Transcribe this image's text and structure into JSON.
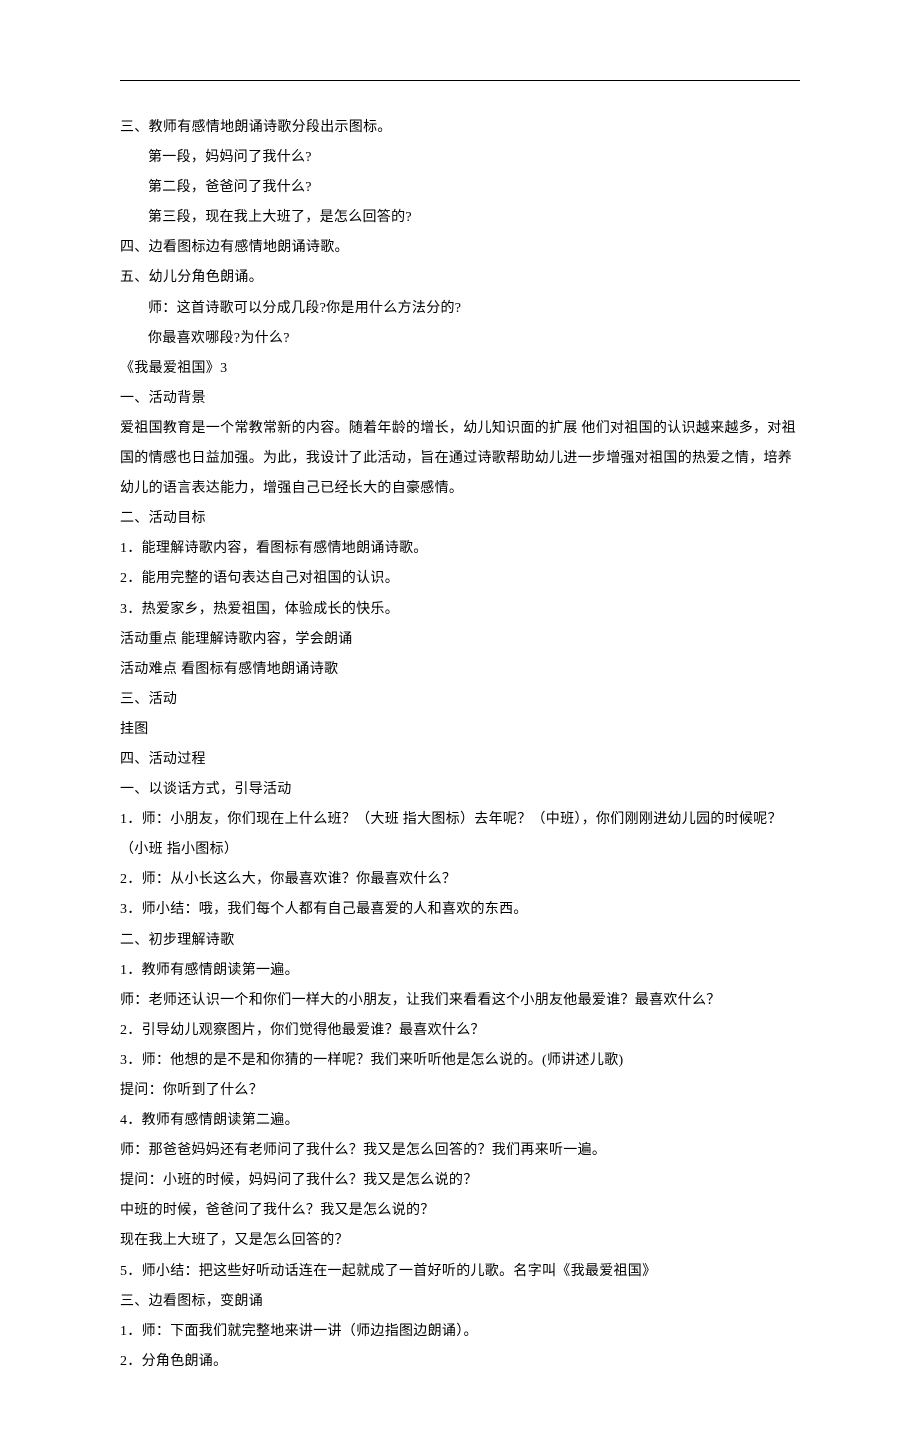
{
  "lines": [
    {
      "t": "三、教师有感情地朗诵诗歌分段出示图标。",
      "i": 0
    },
    {
      "t": "第一段，妈妈问了我什么?",
      "i": 1
    },
    {
      "t": "第二段，爸爸问了我什么?",
      "i": 1
    },
    {
      "t": "第三段，现在我上大班了，是怎么回答的?",
      "i": 1
    },
    {
      "t": "四、边看图标边有感情地朗诵诗歌。",
      "i": 0
    },
    {
      "t": "五、幼儿分角色朗诵。",
      "i": 0
    },
    {
      "t": "师：这首诗歌可以分成几段?你是用什么方法分的?",
      "i": 1
    },
    {
      "t": "你最喜欢哪段?为什么?",
      "i": 1
    },
    {
      "t": "《我最爱祖国》3",
      "i": 0
    },
    {
      "t": "一、活动背景",
      "i": 0
    },
    {
      "t": "爱祖国教育是一个常教常新的内容。随着年龄的增长，幼儿知识面的扩展 他们对祖国的认识越来越多，对祖国的情感也日益加强。为此，我设计了此活动，旨在通过诗歌帮助幼儿进一步增强对祖国的热爱之情，培养幼儿的语言表达能力，增强自己已经长大的自豪感情。",
      "i": 0
    },
    {
      "t": "二、活动目标",
      "i": 0
    },
    {
      "t": "1．能理解诗歌内容，看图标有感情地朗诵诗歌。",
      "i": 0
    },
    {
      "t": "2．能用完整的语句表达自己对祖国的认识。",
      "i": 0
    },
    {
      "t": "3．热爱家乡，热爱祖国，体验成长的快乐。",
      "i": 0
    },
    {
      "t": "活动重点 能理解诗歌内容，学会朗诵",
      "i": 0
    },
    {
      "t": "活动难点 看图标有感情地朗诵诗歌",
      "i": 0
    },
    {
      "t": "三、活动",
      "i": 0
    },
    {
      "t": "挂图",
      "i": 0
    },
    {
      "t": "四、活动过程",
      "i": 0
    },
    {
      "t": "一、以谈话方式，引导活动",
      "i": 0
    },
    {
      "t": "1．师：小朋友，你们现在上什么班？（大班 指大图标）去年呢？（中班），你们刚刚进幼儿园的时候呢？（小班 指小图标）",
      "i": 0
    },
    {
      "t": "2．师：从小长这么大，你最喜欢谁？你最喜欢什么？",
      "i": 0
    },
    {
      "t": "3．师小结：哦，我们每个人都有自己最喜爱的人和喜欢的东西。",
      "i": 0
    },
    {
      "t": "二、初步理解诗歌",
      "i": 0
    },
    {
      "t": "1．教师有感情朗读第一遍。",
      "i": 0
    },
    {
      "t": "师：老师还认识一个和你们一样大的小朋友，让我们来看看这个小朋友他最爱谁？最喜欢什么？",
      "i": 0
    },
    {
      "t": "2．引导幼儿观察图片，你们觉得他最爱谁？最喜欢什么？",
      "i": 0
    },
    {
      "t": "3．师：他想的是不是和你猜的一样呢？我们来听听他是怎么说的。(师讲述儿歌)",
      "i": 0
    },
    {
      "t": "提问：你听到了什么？",
      "i": 0
    },
    {
      "t": "4．教师有感情朗读第二遍。",
      "i": 0
    },
    {
      "t": "师：那爸爸妈妈还有老师问了我什么？我又是怎么回答的？我们再来听一遍。",
      "i": 0
    },
    {
      "t": "提问：小班的时候，妈妈问了我什么？我又是怎么说的？",
      "i": 0
    },
    {
      "t": "中班的时候，爸爸问了我什么？我又是怎么说的？",
      "i": 0
    },
    {
      "t": "现在我上大班了，又是怎么回答的？",
      "i": 0
    },
    {
      "t": "5．师小结：把这些好听动话连在一起就成了一首好听的儿歌。名字叫《我最爱祖国》",
      "i": 0
    },
    {
      "t": "三、边看图标，变朗诵",
      "i": 0
    },
    {
      "t": "1．师：下面我们就完整地来讲一讲（师边指图边朗诵）。",
      "i": 0
    },
    {
      "t": "2．分角色朗诵。",
      "i": 0
    }
  ]
}
